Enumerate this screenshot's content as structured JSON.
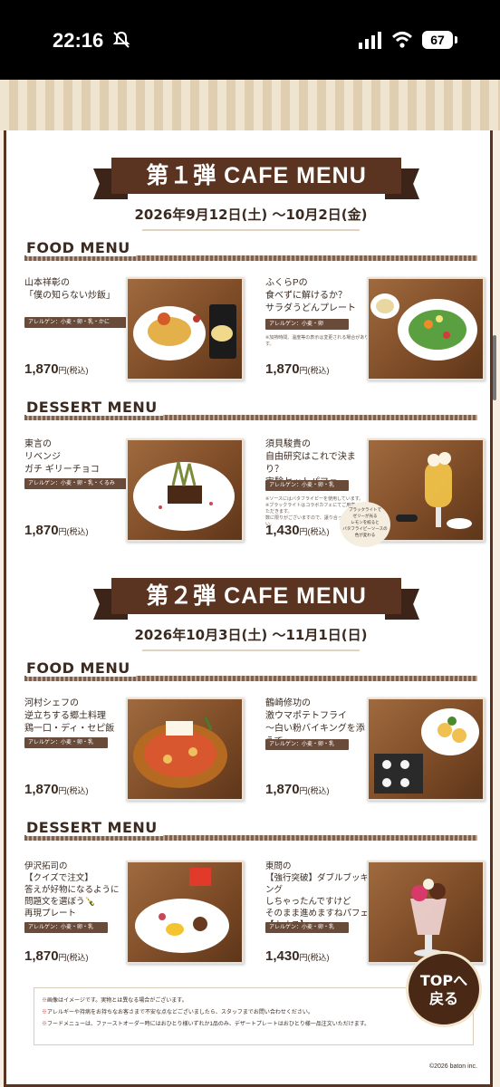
{
  "status": {
    "time": "22:16",
    "battery": "67"
  },
  "phase1": {
    "banner": "第１弾 CAFE MENU",
    "dates": "2026年9月12日(土) ～10月2日(金)",
    "food_title": "FOOD MENU",
    "dessert_title": "DESSERT MENU",
    "items": [
      {
        "name": "山本祥彰の\n「僕の知らない炒飯」",
        "allergy": "アレルゲン：小麦・卵・乳・かに",
        "price": "1,870",
        "tax": "円(税込)"
      },
      {
        "name": "ふくらPの\n食べずに解けるか？\nサラダうどんプレート",
        "allergy": "アレルゲン：小麦・卵",
        "note": "※加熱時間、温度等の表示は変更される場合があります。",
        "price": "1,870",
        "tax": "円(税込)"
      },
      {
        "name": "東言の\nリベンジ\nガチ ギリーチョコ",
        "allergy": "アレルゲン：小麦・卵・乳・くるみ",
        "price": "1,870",
        "tax": "円(税込)"
      },
      {
        "name": "須貝駿貴の\n自由研究はこれで決まり？\n実験セットパフェ",
        "allergy": "アレルゲン：小麦・卵・乳",
        "note": "※ソースにはバタフライピーを使用しています。\n※ブラックライトはコラボカフェにてご用意させていただきます。\n数に限りがございますので、譲り合ってご利用ください。",
        "bubble": "ブラックライトで\nゼリーが光る\nレモンを絞ると\nバタフライピーソースの\n色が変わる",
        "price": "1,430",
        "tax": "円(税込)"
      }
    ]
  },
  "phase2": {
    "banner": "第２弾 CAFE MENU",
    "dates": "2026年10月3日(土) ～11月1日(日)",
    "food_title": "FOOD MENU",
    "dessert_title": "DESSERT MENU",
    "items": [
      {
        "name": "河村シェフの\n逆立ちする郷土料理\n鶏一口・ディ・セピ飯",
        "allergy": "アレルゲン：小麦・卵・乳",
        "price": "1,870",
        "tax": "円(税込)"
      },
      {
        "name": "鶴崎修功の\n激ウマポテトフライ\n～白い粉バイキングを添えて～",
        "allergy": "アレルゲン：小麦・卵・乳",
        "price": "1,870",
        "tax": "円(税込)"
      },
      {
        "name": "伊沢拓司の\n【クイズで注文】\n答えが好物になるように\n問題文を選ぼう🍾\n再現プレート",
        "allergy": "アレルゲン：小麦・卵・乳",
        "price": "1,870",
        "tax": "円(税込)"
      },
      {
        "name": "東問の\n【強行突破】ダブルブッキング\nしちゃったんですけど\nそのまま進めますねパフェ\n【カオス】",
        "allergy": "アレルゲン：小麦・卵・乳",
        "price": "1,430",
        "tax": "円(税込)"
      }
    ]
  },
  "notes": [
    "画像はイメージです。実物とは異なる場合がございます。",
    "アレルギーや持病をお持ちなお客さまで不安な点などございましたら、スタッフまでお問い合わせください。",
    "フードメニューは、ファーストオーダー時にはおひとり様いずれか1品のみ、デザートプレートはおひとり様一品注文いただけます。"
  ],
  "copyright": "©2026 baton inc.",
  "top_button": {
    "line1": "TOPへ",
    "line2": "戻る"
  }
}
